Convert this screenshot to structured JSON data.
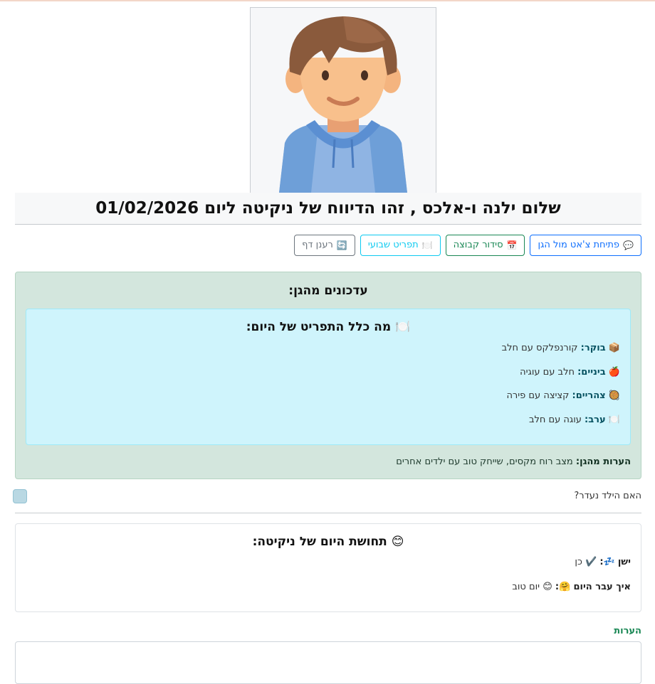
{
  "header": {
    "title": "שלום ילנה ו-אלכס , זהו הדיווח של ניקיטה ליום 01/02/2026"
  },
  "buttons": [
    {
      "icon": "💬",
      "label": "פתיחת צ'אט מול הגן",
      "style": "blue"
    },
    {
      "icon": "📅",
      "label": "סידור קבוצה",
      "style": "green"
    },
    {
      "icon": "🍽️",
      "label": "תפריט שבועי",
      "style": "cyan"
    },
    {
      "icon": "🔄",
      "label": "רענן דף",
      "style": "gray"
    }
  ],
  "updates": {
    "title": "עדכונים מהגן:",
    "menu": {
      "title_icon": "🍽️",
      "title": "מה כלל התפריט של היום:",
      "meals": [
        {
          "icon": "📦",
          "name": "בוקר:",
          "value": "קורנפלקס עם חלב"
        },
        {
          "icon": "🍎",
          "name": "ביניים:",
          "value": "חלב עם עוגיה"
        },
        {
          "icon": "🥘",
          "name": "צהריים:",
          "value": "קציצה עם פירה"
        },
        {
          "icon": "🍽️",
          "name": "ערב:",
          "value": "עוגה עם חלב"
        }
      ]
    },
    "notes_label": "הערות מהגן:",
    "notes_value": "מצב רוח מקסים, שייחק טוב עם ילדים אחרים"
  },
  "absent_question": "האם הילד נעדר?",
  "feeling": {
    "title_icon": "😊",
    "title": "תחושת היום של ניקיטה:",
    "sleep_label": "ישן",
    "sleep_icon": "💤",
    "sleep_check": "✔️",
    "sleep_value": "כן",
    "day_label": "איך עבר היום",
    "day_icon": "🤗",
    "day_value_icon": "😊",
    "day_value": "יום טוב"
  },
  "comments_label": "הערות",
  "colors": {
    "primary": "#0d6efd",
    "success": "#198754",
    "info": "#0dcaf0",
    "secondary": "#6c757d",
    "updates_bg": "#d3e6dd",
    "menu_bg": "#cff4fc"
  }
}
